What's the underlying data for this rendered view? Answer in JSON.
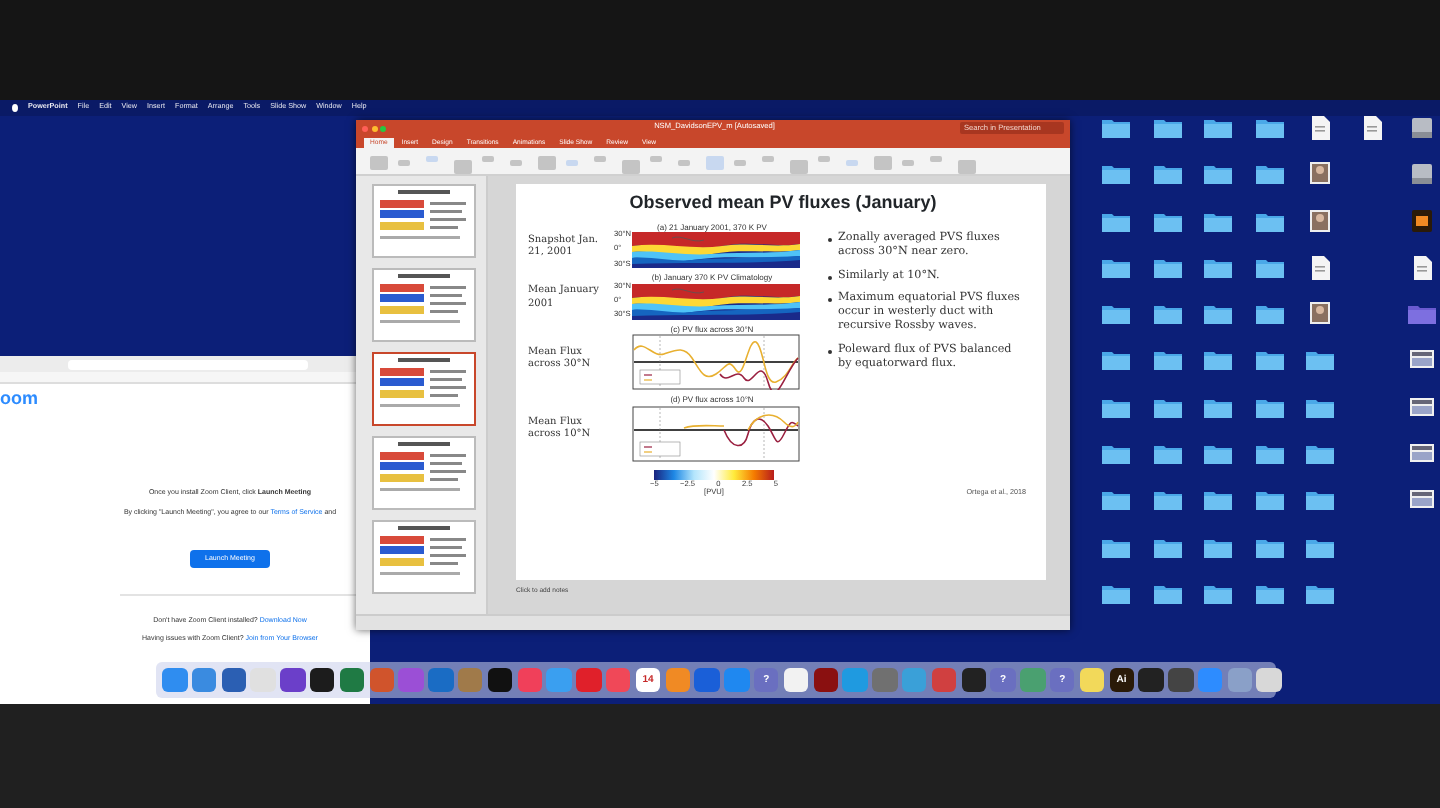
{
  "menu_bar": {
    "items": [
      "PowerPoint",
      "File",
      "Edit",
      "View",
      "Insert",
      "Format",
      "Arrange",
      "Tools",
      "Slide Show",
      "Window",
      "Help"
    ]
  },
  "browser": {
    "logo": "oom",
    "message": "Once you install Zoom Client, click **Launch Meeting**",
    "terms": {
      "text": "By clicking \"Launch Meeting\", you agree to our",
      "link": "Terms of Service",
      "after": "and"
    },
    "button": "Launch Meeting",
    "notes": [
      {
        "text": "Don't have Zoom Client installed?",
        "link": "Download Now"
      },
      {
        "text": "Having issues with Zoom Client?",
        "link": "Join from Your Browser"
      }
    ]
  },
  "powerpoint": {
    "title": "NSM_DavidsonEPV_m [Autosaved]",
    "search": {
      "placeholder": "Search in Presentation"
    },
    "tabs": [
      {
        "label": "Home",
        "selected": true
      },
      {
        "label": "Insert",
        "selected": false
      },
      {
        "label": "Design",
        "selected": false
      },
      {
        "label": "Transitions",
        "selected": false
      },
      {
        "label": "Animations",
        "selected": false
      },
      {
        "label": "Slide Show",
        "selected": false
      },
      {
        "label": "Review",
        "selected": false
      },
      {
        "label": "View",
        "selected": false
      }
    ],
    "thumbnails": [
      {
        "selected": false
      },
      {
        "selected": false
      },
      {
        "selected": true
      },
      {
        "selected": false
      },
      {
        "selected": false
      }
    ],
    "slide": {
      "title": "Observed mean PV fluxes (January)",
      "panels": [
        {
          "kind": "map",
          "label": "Snapshot Jan. 21, 2001",
          "caption": "(a) 21 January 2001, 370 K PV",
          "yticks": [
            "30°N",
            "0°",
            "30°S"
          ]
        },
        {
          "kind": "map",
          "label": "Mean January 2001",
          "caption": "(b) January 370 K PV Climatology",
          "yticks": [
            "30°N",
            "0°",
            "30°S"
          ]
        },
        {
          "kind": "line",
          "label": "Mean Flux across 30°N",
          "caption": "(c) PV flux across 30°N"
        },
        {
          "kind": "line",
          "label": "Mean Flux across 10°N",
          "caption": "(d) PV flux across 10°N"
        }
      ],
      "bullets": [
        "Zonally averaged PVS fluxes across 30°N near zero.",
        "Similarly at 10°N.",
        "Maximum equatorial PVS fluxes occur in westerly duct with recursive Rossby waves.",
        "Poleward flux of PVS balanced by equatorward flux."
      ],
      "colorbar": {
        "ticks": [
          "−5",
          "−2.5",
          "0",
          "2.5",
          "5"
        ],
        "unit": "[PVU]"
      },
      "citation": "Ortega et al., 2018"
    },
    "notes": {
      "placeholder": "Click to add notes"
    }
  },
  "desktop": {
    "icons": [
      {
        "kind": "folder"
      },
      {
        "kind": "folder"
      },
      {
        "kind": "folder"
      },
      {
        "kind": "folder"
      },
      {
        "kind": "document"
      },
      {
        "kind": "document"
      },
      {
        "kind": "drive"
      },
      {
        "kind": "folder"
      },
      {
        "kind": "folder"
      },
      {
        "kind": "folder"
      },
      {
        "kind": "folder"
      },
      {
        "kind": "image"
      },
      {
        "kind": "blank"
      },
      {
        "kind": "drive"
      },
      {
        "kind": "folder"
      },
      {
        "kind": "folder"
      },
      {
        "kind": "folder"
      },
      {
        "kind": "folder"
      },
      {
        "kind": "image"
      },
      {
        "kind": "blank"
      },
      {
        "kind": "app"
      },
      {
        "kind": "folder"
      },
      {
        "kind": "folder"
      },
      {
        "kind": "folder"
      },
      {
        "kind": "folder"
      },
      {
        "kind": "document"
      },
      {
        "kind": "blank"
      },
      {
        "kind": "document"
      },
      {
        "kind": "folder"
      },
      {
        "kind": "folder"
      },
      {
        "kind": "folder"
      },
      {
        "kind": "folder"
      },
      {
        "kind": "image"
      },
      {
        "kind": "blank"
      },
      {
        "kind": "purplefolder"
      },
      {
        "kind": "folder"
      },
      {
        "kind": "folder"
      },
      {
        "kind": "folder"
      },
      {
        "kind": "folder"
      },
      {
        "kind": "folder"
      },
      {
        "kind": "blank"
      },
      {
        "kind": "screenshot"
      },
      {
        "kind": "folder"
      },
      {
        "kind": "folder"
      },
      {
        "kind": "folder"
      },
      {
        "kind": "folder"
      },
      {
        "kind": "folder"
      },
      {
        "kind": "blank"
      },
      {
        "kind": "screenshot"
      },
      {
        "kind": "folder"
      },
      {
        "kind": "folder"
      },
      {
        "kind": "folder"
      },
      {
        "kind": "folder"
      },
      {
        "kind": "folder"
      },
      {
        "kind": "blank"
      },
      {
        "kind": "screenshot"
      },
      {
        "kind": "folder"
      },
      {
        "kind": "folder"
      },
      {
        "kind": "folder"
      },
      {
        "kind": "folder"
      },
      {
        "kind": "folder"
      },
      {
        "kind": "blank"
      },
      {
        "kind": "screenshot"
      },
      {
        "kind": "folder"
      },
      {
        "kind": "folder"
      },
      {
        "kind": "folder"
      },
      {
        "kind": "folder"
      },
      {
        "kind": "folder"
      },
      {
        "kind": "blank"
      },
      {
        "kind": "blank"
      },
      {
        "kind": "folder"
      },
      {
        "kind": "folder"
      },
      {
        "kind": "folder"
      },
      {
        "kind": "folder"
      },
      {
        "kind": "folder"
      },
      {
        "kind": "blank"
      },
      {
        "kind": "blank"
      }
    ]
  },
  "dock": [
    {
      "color": "#2f8df0"
    },
    {
      "color": "#3a8be0"
    },
    {
      "color": "#2b5fb3"
    },
    {
      "color": "#e0e0e0"
    },
    {
      "color": "#6b3fc9"
    },
    {
      "color": "#1c1c1c"
    },
    {
      "color": "#1f7a44"
    },
    {
      "color": "#d0542c"
    },
    {
      "color": "#9b4fd6"
    },
    {
      "color": "#1a6cc4"
    },
    {
      "color": "#a07a4a"
    },
    {
      "color": "#111111"
    },
    {
      "color": "#f0405a"
    },
    {
      "color": "#3a9ff0"
    },
    {
      "color": "#e0202a"
    },
    {
      "color": "#f04858"
    },
    {
      "color": "#ffffff",
      "glyph": "14"
    },
    {
      "color": "#f08a24"
    },
    {
      "color": "#1a5fd8"
    },
    {
      "color": "#1f88f0"
    },
    {
      "color": "#6a6fc0",
      "glyph": "?"
    },
    {
      "color": "#f2f2f2"
    },
    {
      "color": "#8a1010"
    },
    {
      "color": "#1f9ae0"
    },
    {
      "color": "#707070"
    },
    {
      "color": "#3aa0d8"
    },
    {
      "color": "#d04040"
    },
    {
      "color": "#222222"
    },
    {
      "color": "#6a6fc0",
      "glyph": "?"
    },
    {
      "color": "#4aa070"
    },
    {
      "color": "#6a6fc0",
      "glyph": "?"
    },
    {
      "color": "#f2d95a"
    },
    {
      "color": "#2a1a08",
      "glyph": "Ai"
    },
    {
      "color": "#222222"
    },
    {
      "color": "#444444"
    },
    {
      "color": "#2d8cff"
    },
    {
      "color": "#8aa0c8"
    },
    {
      "color": "#d8d8d8"
    }
  ]
}
